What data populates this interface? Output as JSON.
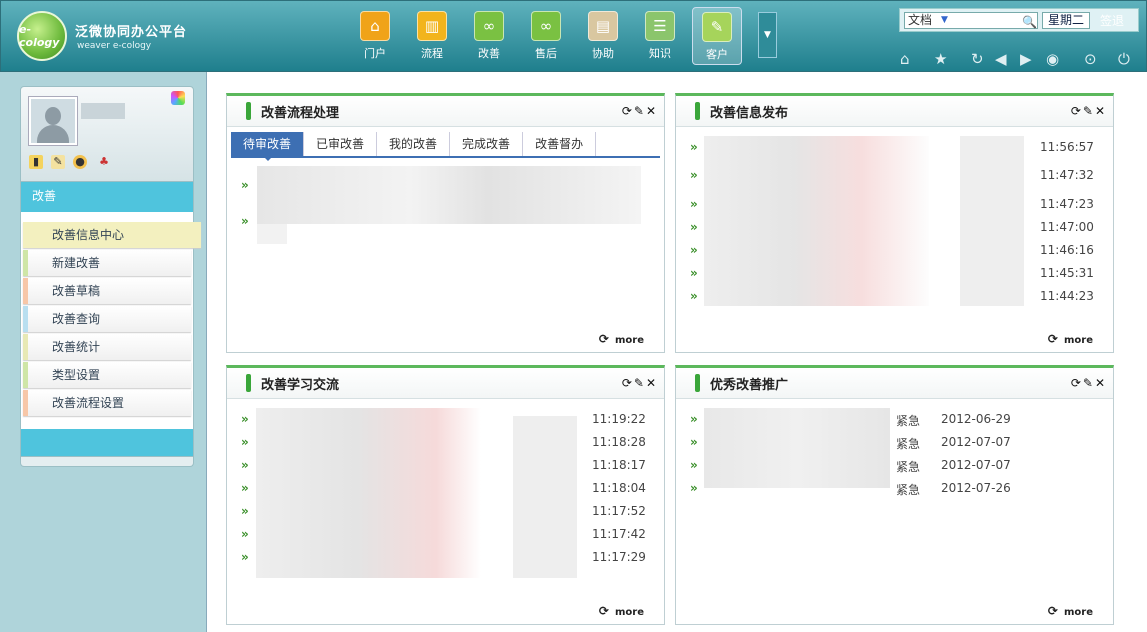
{
  "header": {
    "logo_text": "e-cology",
    "app_title": "泛微协同办公平台",
    "app_subtitle": "weaver e-cology",
    "nav": [
      {
        "label": "门户",
        "icon": "home-icon",
        "color": "#f0a319"
      },
      {
        "label": "流程",
        "icon": "chart-icon",
        "color": "#f2b41c"
      },
      {
        "label": "改善",
        "icon": "infinity-icon",
        "color": "#7ac142"
      },
      {
        "label": "售后",
        "icon": "infinity-icon",
        "color": "#7ac142"
      },
      {
        "label": "协助",
        "icon": "clipboard-icon",
        "color": "#d9c7a0"
      },
      {
        "label": "知识",
        "icon": "server-icon",
        "color": "#8bc56c"
      },
      {
        "label": "客户",
        "icon": "customer-icon",
        "color": "#a6d45b"
      }
    ],
    "search": {
      "type": "文档",
      "weekday": "星期二",
      "signin": "签退"
    }
  },
  "sidebar": {
    "section": "改善",
    "items": [
      {
        "label": "改善信息中心",
        "accent": "#f3f0bf"
      },
      {
        "label": "新建改善",
        "accent": "#cfe6a7"
      },
      {
        "label": "改善草稿",
        "accent": "#f7c7a8"
      },
      {
        "label": "改善查询",
        "accent": "#b9dff0"
      },
      {
        "label": "改善统计",
        "accent": "#e8e9b5"
      },
      {
        "label": "类型设置",
        "accent": "#cfe6a7"
      },
      {
        "label": "改善流程设置",
        "accent": "#f7c7a8"
      }
    ]
  },
  "panels": {
    "process": {
      "title": "改善流程处理",
      "tabs": [
        "待审改善",
        "已审改善",
        "我的改善",
        "完成改善",
        "改善督办"
      ],
      "more": "more"
    },
    "info": {
      "title": "改善信息发布",
      "times": [
        "11:56:57",
        "11:47:32",
        "11:47:23",
        "11:47:00",
        "11:46:16",
        "11:45:31",
        "11:44:23"
      ],
      "more": "more"
    },
    "study": {
      "title": "改善学习交流",
      "times": [
        "11:19:22",
        "11:18:28",
        "11:18:17",
        "11:18:04",
        "11:17:52",
        "11:17:42",
        "11:17:29"
      ],
      "more": "more"
    },
    "excellent": {
      "title": "优秀改善推广",
      "rows": [
        {
          "level": "紧急",
          "date": "2012-06-29"
        },
        {
          "level": "紧急",
          "date": "2012-07-07"
        },
        {
          "level": "紧急",
          "date": "2012-07-07"
        },
        {
          "level": "紧急",
          "date": "2012-07-26"
        }
      ],
      "more": "more"
    }
  }
}
